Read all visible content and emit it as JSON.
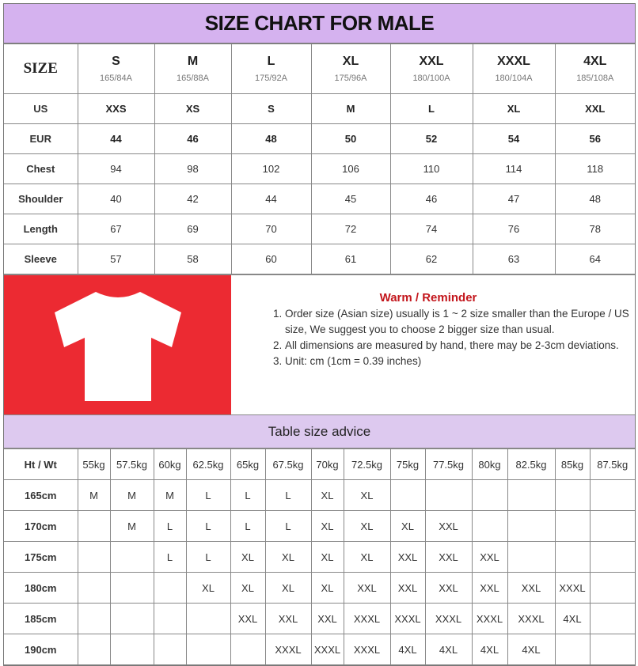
{
  "title": "SIZE CHART FOR MALE",
  "size_table": {
    "corner": "SIZE",
    "sizes": [
      {
        "name": "S",
        "code": "165/84A"
      },
      {
        "name": "M",
        "code": "165/88A"
      },
      {
        "name": "L",
        "code": "175/92A"
      },
      {
        "name": "XL",
        "code": "175/96A"
      },
      {
        "name": "XXL",
        "code": "180/100A"
      },
      {
        "name": "XXXL",
        "code": "180/104A"
      },
      {
        "name": "4XL",
        "code": "185/108A"
      }
    ],
    "rows": [
      {
        "label": "US",
        "values": [
          "XXS",
          "XS",
          "S",
          "M",
          "L",
          "XL",
          "XXL"
        ]
      },
      {
        "label": "EUR",
        "values": [
          "44",
          "46",
          "48",
          "50",
          "52",
          "54",
          "56"
        ]
      },
      {
        "label": "Chest",
        "values": [
          "94",
          "98",
          "102",
          "106",
          "110",
          "114",
          "118"
        ]
      },
      {
        "label": "Shoulder",
        "values": [
          "40",
          "42",
          "44",
          "45",
          "46",
          "47",
          "48"
        ]
      },
      {
        "label": "Length",
        "values": [
          "67",
          "69",
          "70",
          "72",
          "74",
          "76",
          "78"
        ]
      },
      {
        "label": "Sleeve",
        "values": [
          "57",
          "58",
          "60",
          "61",
          "62",
          "63",
          "64"
        ]
      }
    ]
  },
  "reminder": {
    "title": "Warm / Reminder",
    "items": [
      "Order size (Asian size) usually is 1 ~ 2 size smaller than the Europe / US size, We suggest you to choose 2 bigger size than usual.",
      "All dimensions are measured by hand, there may be 2-3cm deviations.",
      "Unit: cm (1cm = 0.39 inches)"
    ]
  },
  "colors": {
    "header": "#d5b2ef",
    "tshirt_bg": "#ec2a32",
    "reminder_title": "#c3161c"
  },
  "advice": {
    "title": "Table size advice",
    "corner": "Ht / Wt",
    "weights": [
      "55kg",
      "57.5kg",
      "60kg",
      "62.5kg",
      "65kg",
      "67.5kg",
      "70kg",
      "72.5kg",
      "75kg",
      "77.5kg",
      "80kg",
      "82.5kg",
      "85kg",
      "87.5kg"
    ],
    "rows": [
      {
        "height": "165cm",
        "values": [
          "M",
          "M",
          "M",
          "L",
          "L",
          "L",
          "XL",
          "XL",
          "",
          "",
          "",
          "",
          "",
          ""
        ]
      },
      {
        "height": "170cm",
        "values": [
          "",
          "M",
          "L",
          "L",
          "L",
          "L",
          "XL",
          "XL",
          "XL",
          "XXL",
          "",
          "",
          "",
          ""
        ]
      },
      {
        "height": "175cm",
        "values": [
          "",
          "",
          "L",
          "L",
          "XL",
          "XL",
          "XL",
          "XL",
          "XXL",
          "XXL",
          "XXL",
          "",
          "",
          ""
        ]
      },
      {
        "height": "180cm",
        "values": [
          "",
          "",
          "",
          "XL",
          "XL",
          "XL",
          "XL",
          "XXL",
          "XXL",
          "XXL",
          "XXL",
          "XXL",
          "XXXL",
          ""
        ]
      },
      {
        "height": "185cm",
        "values": [
          "",
          "",
          "",
          "",
          "XXL",
          "XXL",
          "XXL",
          "XXXL",
          "XXXL",
          "XXXL",
          "XXXL",
          "XXXL",
          "4XL",
          ""
        ]
      },
      {
        "height": "190cm",
        "values": [
          "",
          "",
          "",
          "",
          "",
          "XXXL",
          "XXXL",
          "XXXL",
          "4XL",
          "4XL",
          "4XL",
          "4XL",
          "",
          ""
        ]
      }
    ]
  }
}
